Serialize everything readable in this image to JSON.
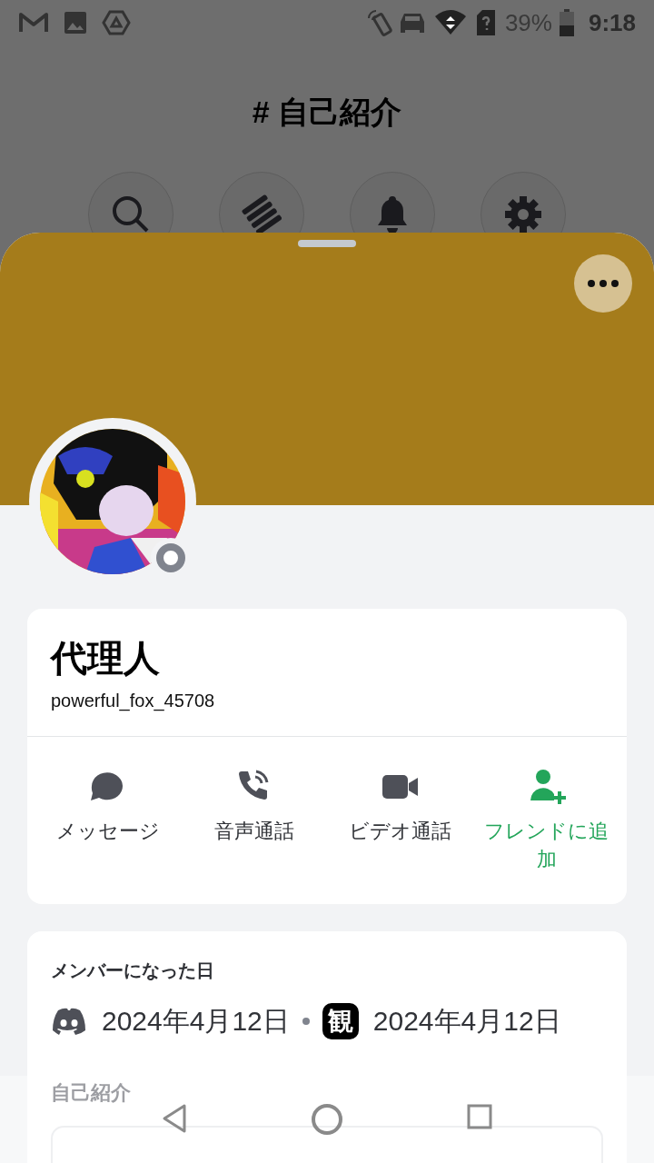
{
  "status_bar": {
    "battery": "39%",
    "time": "9:18"
  },
  "channel_header": {
    "title": "# 自己紹介"
  },
  "profile": {
    "display_name": "代理人",
    "username": "powerful_fox_45708",
    "online": false
  },
  "actions": [
    {
      "kind": "message",
      "label": "メッセージ"
    },
    {
      "kind": "voice",
      "label": "音声通話"
    },
    {
      "kind": "video",
      "label": "ビデオ通話"
    },
    {
      "kind": "add_friend",
      "label": "フレンドに追加"
    }
  ],
  "member_since": {
    "heading": "メンバーになった日",
    "entries": [
      {
        "kind": "discord",
        "date": "2024年4月12日"
      },
      {
        "kind": "server",
        "icon_text": "観",
        "date": "2024年4月12日"
      }
    ]
  },
  "about": {
    "heading": "自己紹介"
  }
}
